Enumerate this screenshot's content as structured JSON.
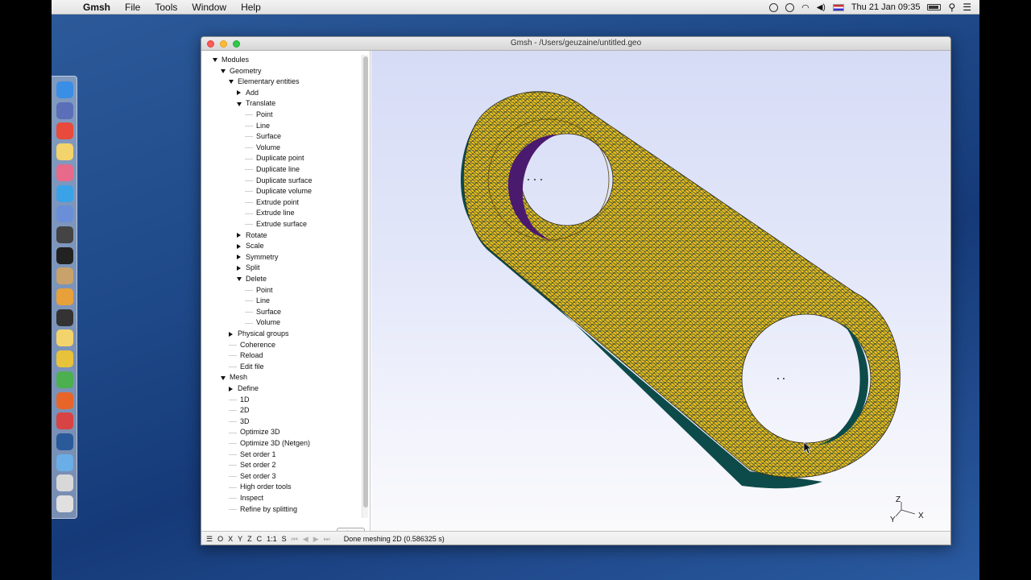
{
  "menubar": {
    "apple_icon": "apple-icon",
    "app_name": "Gmsh",
    "menus": [
      "File",
      "Tools",
      "Window",
      "Help"
    ],
    "clock": "Thu 21 Jan  09:35",
    "battery_text": "",
    "status_icons": [
      "timemachine-icon",
      "history-icon",
      "wifi-icon",
      "volume-icon",
      "flag-icon",
      "battery-icon",
      "search-icon",
      "notification-list-icon"
    ]
  },
  "window": {
    "title": "Gmsh - /Users/geuzaine/untitled.geo"
  },
  "tree": {
    "items": [
      {
        "label": "Modules",
        "state": "open",
        "depth": 0
      },
      {
        "label": "Geometry",
        "state": "open",
        "depth": 1
      },
      {
        "label": "Elementary entities",
        "state": "open",
        "depth": 2
      },
      {
        "label": "Add",
        "state": "closed",
        "depth": 3
      },
      {
        "label": "Translate",
        "state": "open",
        "depth": 3
      },
      {
        "label": "Point",
        "state": "leaf",
        "depth": 4
      },
      {
        "label": "Line",
        "state": "leaf",
        "depth": 4
      },
      {
        "label": "Surface",
        "state": "leaf",
        "depth": 4
      },
      {
        "label": "Volume",
        "state": "leaf",
        "depth": 4
      },
      {
        "label": "Duplicate point",
        "state": "leaf",
        "depth": 4
      },
      {
        "label": "Duplicate line",
        "state": "leaf",
        "depth": 4
      },
      {
        "label": "Duplicate surface",
        "state": "leaf",
        "depth": 4
      },
      {
        "label": "Duplicate volume",
        "state": "leaf",
        "depth": 4
      },
      {
        "label": "Extrude point",
        "state": "leaf",
        "depth": 4
      },
      {
        "label": "Extrude line",
        "state": "leaf",
        "depth": 4
      },
      {
        "label": "Extrude surface",
        "state": "leaf",
        "depth": 4
      },
      {
        "label": "Rotate",
        "state": "closed",
        "depth": 3
      },
      {
        "label": "Scale",
        "state": "closed",
        "depth": 3
      },
      {
        "label": "Symmetry",
        "state": "closed",
        "depth": 3
      },
      {
        "label": "Split",
        "state": "closed",
        "depth": 3
      },
      {
        "label": "Delete",
        "state": "open",
        "depth": 3
      },
      {
        "label": "Point",
        "state": "leaf",
        "depth": 4
      },
      {
        "label": "Line",
        "state": "leaf",
        "depth": 4
      },
      {
        "label": "Surface",
        "state": "leaf",
        "depth": 4
      },
      {
        "label": "Volume",
        "state": "leaf",
        "depth": 4
      },
      {
        "label": "Physical groups",
        "state": "closed",
        "depth": 2
      },
      {
        "label": "Coherence",
        "state": "leaf",
        "depth": 2
      },
      {
        "label": "Reload",
        "state": "leaf",
        "depth": 2
      },
      {
        "label": "Edit file",
        "state": "leaf",
        "depth": 2
      },
      {
        "label": "Mesh",
        "state": "open",
        "depth": 1
      },
      {
        "label": "Define",
        "state": "closed",
        "depth": 2
      },
      {
        "label": "1D",
        "state": "leaf",
        "depth": 2
      },
      {
        "label": "2D",
        "state": "leaf",
        "depth": 2
      },
      {
        "label": "3D",
        "state": "leaf",
        "depth": 2
      },
      {
        "label": "Optimize 3D",
        "state": "leaf",
        "depth": 2
      },
      {
        "label": "Optimize 3D (Netgen)",
        "state": "leaf",
        "depth": 2
      },
      {
        "label": "Set order 1",
        "state": "leaf",
        "depth": 2
      },
      {
        "label": "Set order 2",
        "state": "leaf",
        "depth": 2
      },
      {
        "label": "Set order 3",
        "state": "leaf",
        "depth": 2
      },
      {
        "label": "High order tools",
        "state": "leaf",
        "depth": 2
      },
      {
        "label": "Inspect",
        "state": "leaf",
        "depth": 2
      },
      {
        "label": "Refine by splitting",
        "state": "leaf",
        "depth": 2
      }
    ],
    "gear_button": "⚙ ▾"
  },
  "statusbar": {
    "buttons": [
      "☰",
      "O",
      "X",
      "Y",
      "Z",
      "C",
      "1:1",
      "S"
    ],
    "playback": [
      "⏮",
      "◀",
      "▶",
      "⏭"
    ],
    "message": "Done meshing 2D (0.586325 s)"
  },
  "axes": {
    "z_label": "Z",
    "x_label": "X",
    "y_label": "Y"
  },
  "colors": {
    "mesh_fill": "#f2c118",
    "mesh_edge": "#1e3f44",
    "side_wall": "#0d4b4a",
    "inner_wall": "#4a1a6e"
  }
}
